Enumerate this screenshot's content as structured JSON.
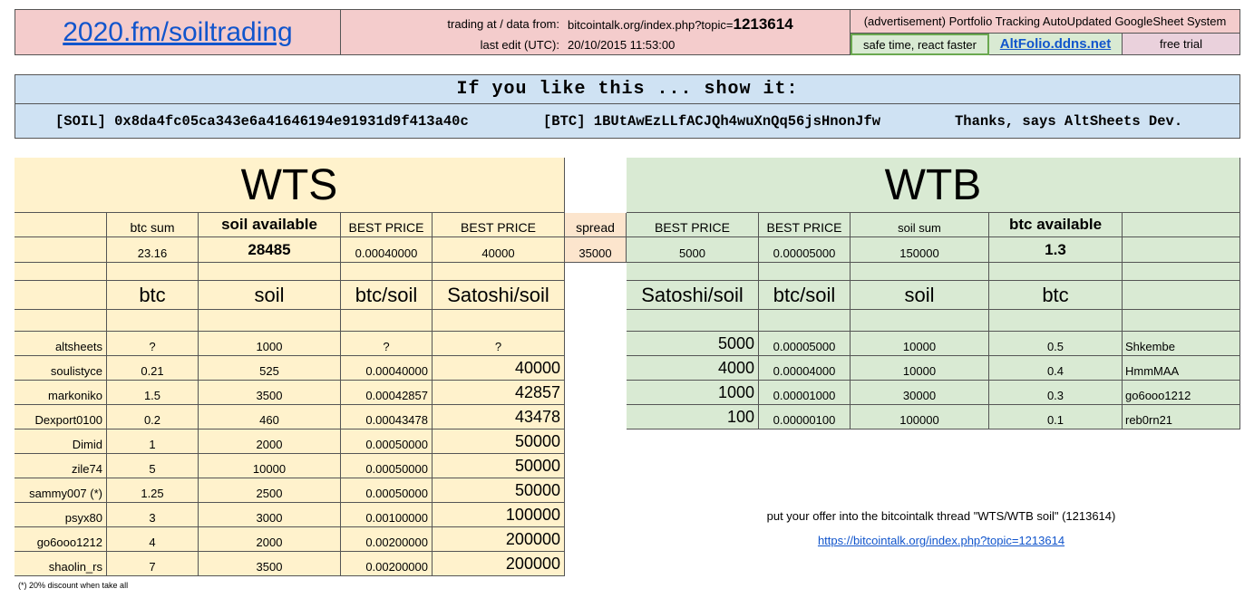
{
  "header": {
    "site_link": "2020.fm/soiltrading",
    "trading_label": "trading at / data from:",
    "trading_value": "bitcointalk.org/index.php?topic=",
    "topic_id": "1213614",
    "edit_label": "last edit (UTC):",
    "edit_value": "20/10/2015 11:53:00",
    "ad_text": "(advertisement) Portfolio Tracking AutoUpdated GoogleSheet System",
    "safe_text": "safe time, react faster",
    "altfolio_link": "AltFolio.ddns.net",
    "free_trial": "free trial"
  },
  "donation": {
    "title": "If you like this ... show it:",
    "soil": "[SOIL] 0x8da4fc05ca343e6a41646194e91931d9f413a40c",
    "btc": "[BTC] 1BUtAwEzLLfACJQh4wuXnQq56jsHnonJfw",
    "thanks": "Thanks, says AltSheets Dev."
  },
  "wts": {
    "title": "WTS",
    "col_btc_sum": "btc sum",
    "col_soil_available": "soil available",
    "col_best_price_1": "BEST PRICE",
    "col_best_price_2": "BEST PRICE",
    "btc_sum": "23.16",
    "soil_available": "28485",
    "best_price_btc": "0.00040000",
    "best_price_sat": "40000",
    "unit_btc": "btc",
    "unit_soil": "soil",
    "unit_btc_soil": "btc/soil",
    "unit_sat_soil": "Satoshi/soil",
    "rows": [
      {
        "name": "altsheets",
        "btc": "?",
        "soil": "1000",
        "price": "?",
        "sat": "?"
      },
      {
        "name": "soulistyce",
        "btc": "0.21",
        "soil": "525",
        "price": "0.00040000",
        "sat": "40000"
      },
      {
        "name": "markoniko",
        "btc": "1.5",
        "soil": "3500",
        "price": "0.00042857",
        "sat": "42857"
      },
      {
        "name": "Dexport0100",
        "btc": "0.2",
        "soil": "460",
        "price": "0.00043478",
        "sat": "43478"
      },
      {
        "name": "Dimid",
        "btc": "1",
        "soil": "2000",
        "price": "0.00050000",
        "sat": "50000"
      },
      {
        "name": "zile74",
        "btc": "5",
        "soil": "10000",
        "price": "0.00050000",
        "sat": "50000"
      },
      {
        "name": "sammy007 (*)",
        "btc": "1.25",
        "soil": "2500",
        "price": "0.00050000",
        "sat": "50000"
      },
      {
        "name": "psyx80",
        "btc": "3",
        "soil": "3000",
        "price": "0.00100000",
        "sat": "100000"
      },
      {
        "name": "go6ooo1212",
        "btc": "4",
        "soil": "2000",
        "price": "0.00200000",
        "sat": "200000"
      },
      {
        "name": "shaolin_rs",
        "btc": "7",
        "soil": "3500",
        "price": "0.00200000",
        "sat": "200000"
      }
    ],
    "footnote": "(*) 20% discount when take all"
  },
  "spread": {
    "label": "spread",
    "value": "35000"
  },
  "wtb": {
    "title": "WTB",
    "col_best_price_1": "BEST PRICE",
    "col_best_price_2": "BEST PRICE",
    "col_soil_sum": "soil sum",
    "col_btc_available": "btc available",
    "best_price_sat": "5000",
    "best_price_btc": "0.00005000",
    "soil_sum": "150000",
    "btc_available": "1.3",
    "unit_sat_soil": "Satoshi/soil",
    "unit_btc_soil": "btc/soil",
    "unit_soil": "soil",
    "unit_btc": "btc",
    "rows": [
      {
        "sat": "5000",
        "price": "0.00005000",
        "soil": "10000",
        "btc": "0.5",
        "name": "Shkembe"
      },
      {
        "sat": "4000",
        "price": "0.00004000",
        "soil": "10000",
        "btc": "0.4",
        "name": "HmmMAA"
      },
      {
        "sat": "1000",
        "price": "0.00001000",
        "soil": "30000",
        "btc": "0.3",
        "name": "go6ooo1212"
      },
      {
        "sat": "100",
        "price": "0.00000100",
        "soil": "100000",
        "btc": "0.1",
        "name": "reb0rn21"
      }
    ]
  },
  "offer": {
    "text": "put your offer into the bitcointalk thread \"WTS/WTB soil\" (1213614)",
    "link": "https://bitcointalk.org/index.php?topic=1213614"
  }
}
